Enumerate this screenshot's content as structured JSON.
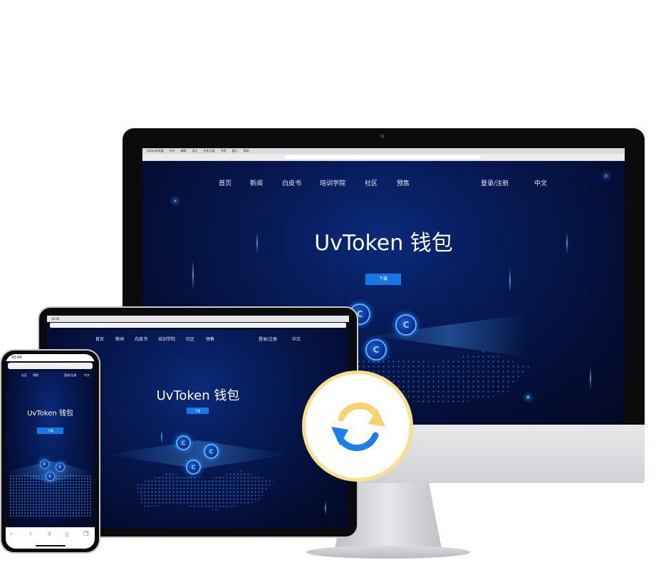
{
  "desktop": {
    "menubar": [
      "Safari浏览器",
      "文件",
      "编辑",
      "显示",
      "历史记录",
      "书签",
      "窗口",
      "帮助"
    ],
    "nav": {
      "items": [
        "首页",
        "新闻",
        "白皮书",
        "培训学院",
        "社区",
        "预售"
      ],
      "login": "登录/注册",
      "lang": "中文"
    },
    "hero_title": "UvToken 钱包",
    "download_label": "下载"
  },
  "tablet": {
    "status_time": "10:45",
    "nav": {
      "items": [
        "首页",
        "新闻",
        "白皮书",
        "培训学院",
        "社区",
        "预售"
      ],
      "login": "登录/注册",
      "lang": "中文"
    },
    "hero_title": "UvToken 钱包",
    "download_label": "下载"
  },
  "phone": {
    "status_time": "10:44",
    "url_text": "",
    "nav": {
      "items": [
        "社区",
        "预售"
      ],
      "login": "登录/注册",
      "lang": "中文"
    },
    "hero_title": "UvToken 钱包",
    "download_label": "下载"
  },
  "sync_badge": {
    "icon": "sync-icon",
    "colors": {
      "ring": "#fbe08a",
      "blue": "#1b7ff0",
      "yellow": "#f8d36a"
    }
  },
  "colors": {
    "bg_dark": "#040d33",
    "accent": "#1677e6",
    "bezel": "#0b0b0c",
    "stand": "#cfd1d5"
  }
}
